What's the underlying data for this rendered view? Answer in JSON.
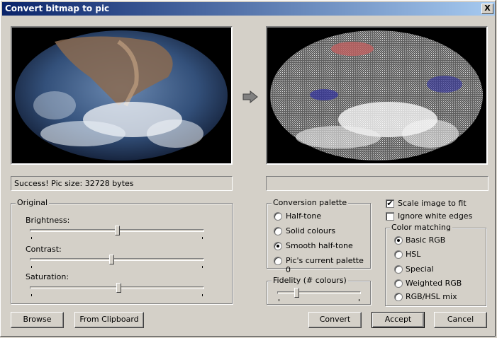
{
  "window": {
    "title": "Convert bitmap to pic",
    "close_label": "X"
  },
  "status": {
    "left": "Success! Pic size: 32728 bytes",
    "right": ""
  },
  "original": {
    "label": "Original",
    "sliders": [
      {
        "label": "Brightness:",
        "value": 0.5
      },
      {
        "label": "Contrast:",
        "value": 0.47
      },
      {
        "label": "Saturation:",
        "value": 0.51
      }
    ]
  },
  "palette": {
    "label": "Conversion palette",
    "options": [
      "Half-tone",
      "Solid colours",
      "Smooth half-tone",
      "Pic's current palette 0"
    ],
    "selected": 2
  },
  "fidelity": {
    "label": "Fidelity (# colours)",
    "value": 0.22
  },
  "options": {
    "scale_label": "Scale image to fit",
    "scale_checked": true,
    "ignore_label": "Ignore white edges",
    "ignore_checked": false
  },
  "color_matching": {
    "label": "Color matching",
    "options": [
      "Basic RGB",
      "HSL",
      "Special",
      "Weighted RGB",
      "RGB/HSL mix"
    ],
    "selected": 0
  },
  "buttons": {
    "browse": "Browse",
    "clipboard": "From Clipboard",
    "convert": "Convert",
    "accept": "Accept",
    "cancel": "Cancel"
  }
}
